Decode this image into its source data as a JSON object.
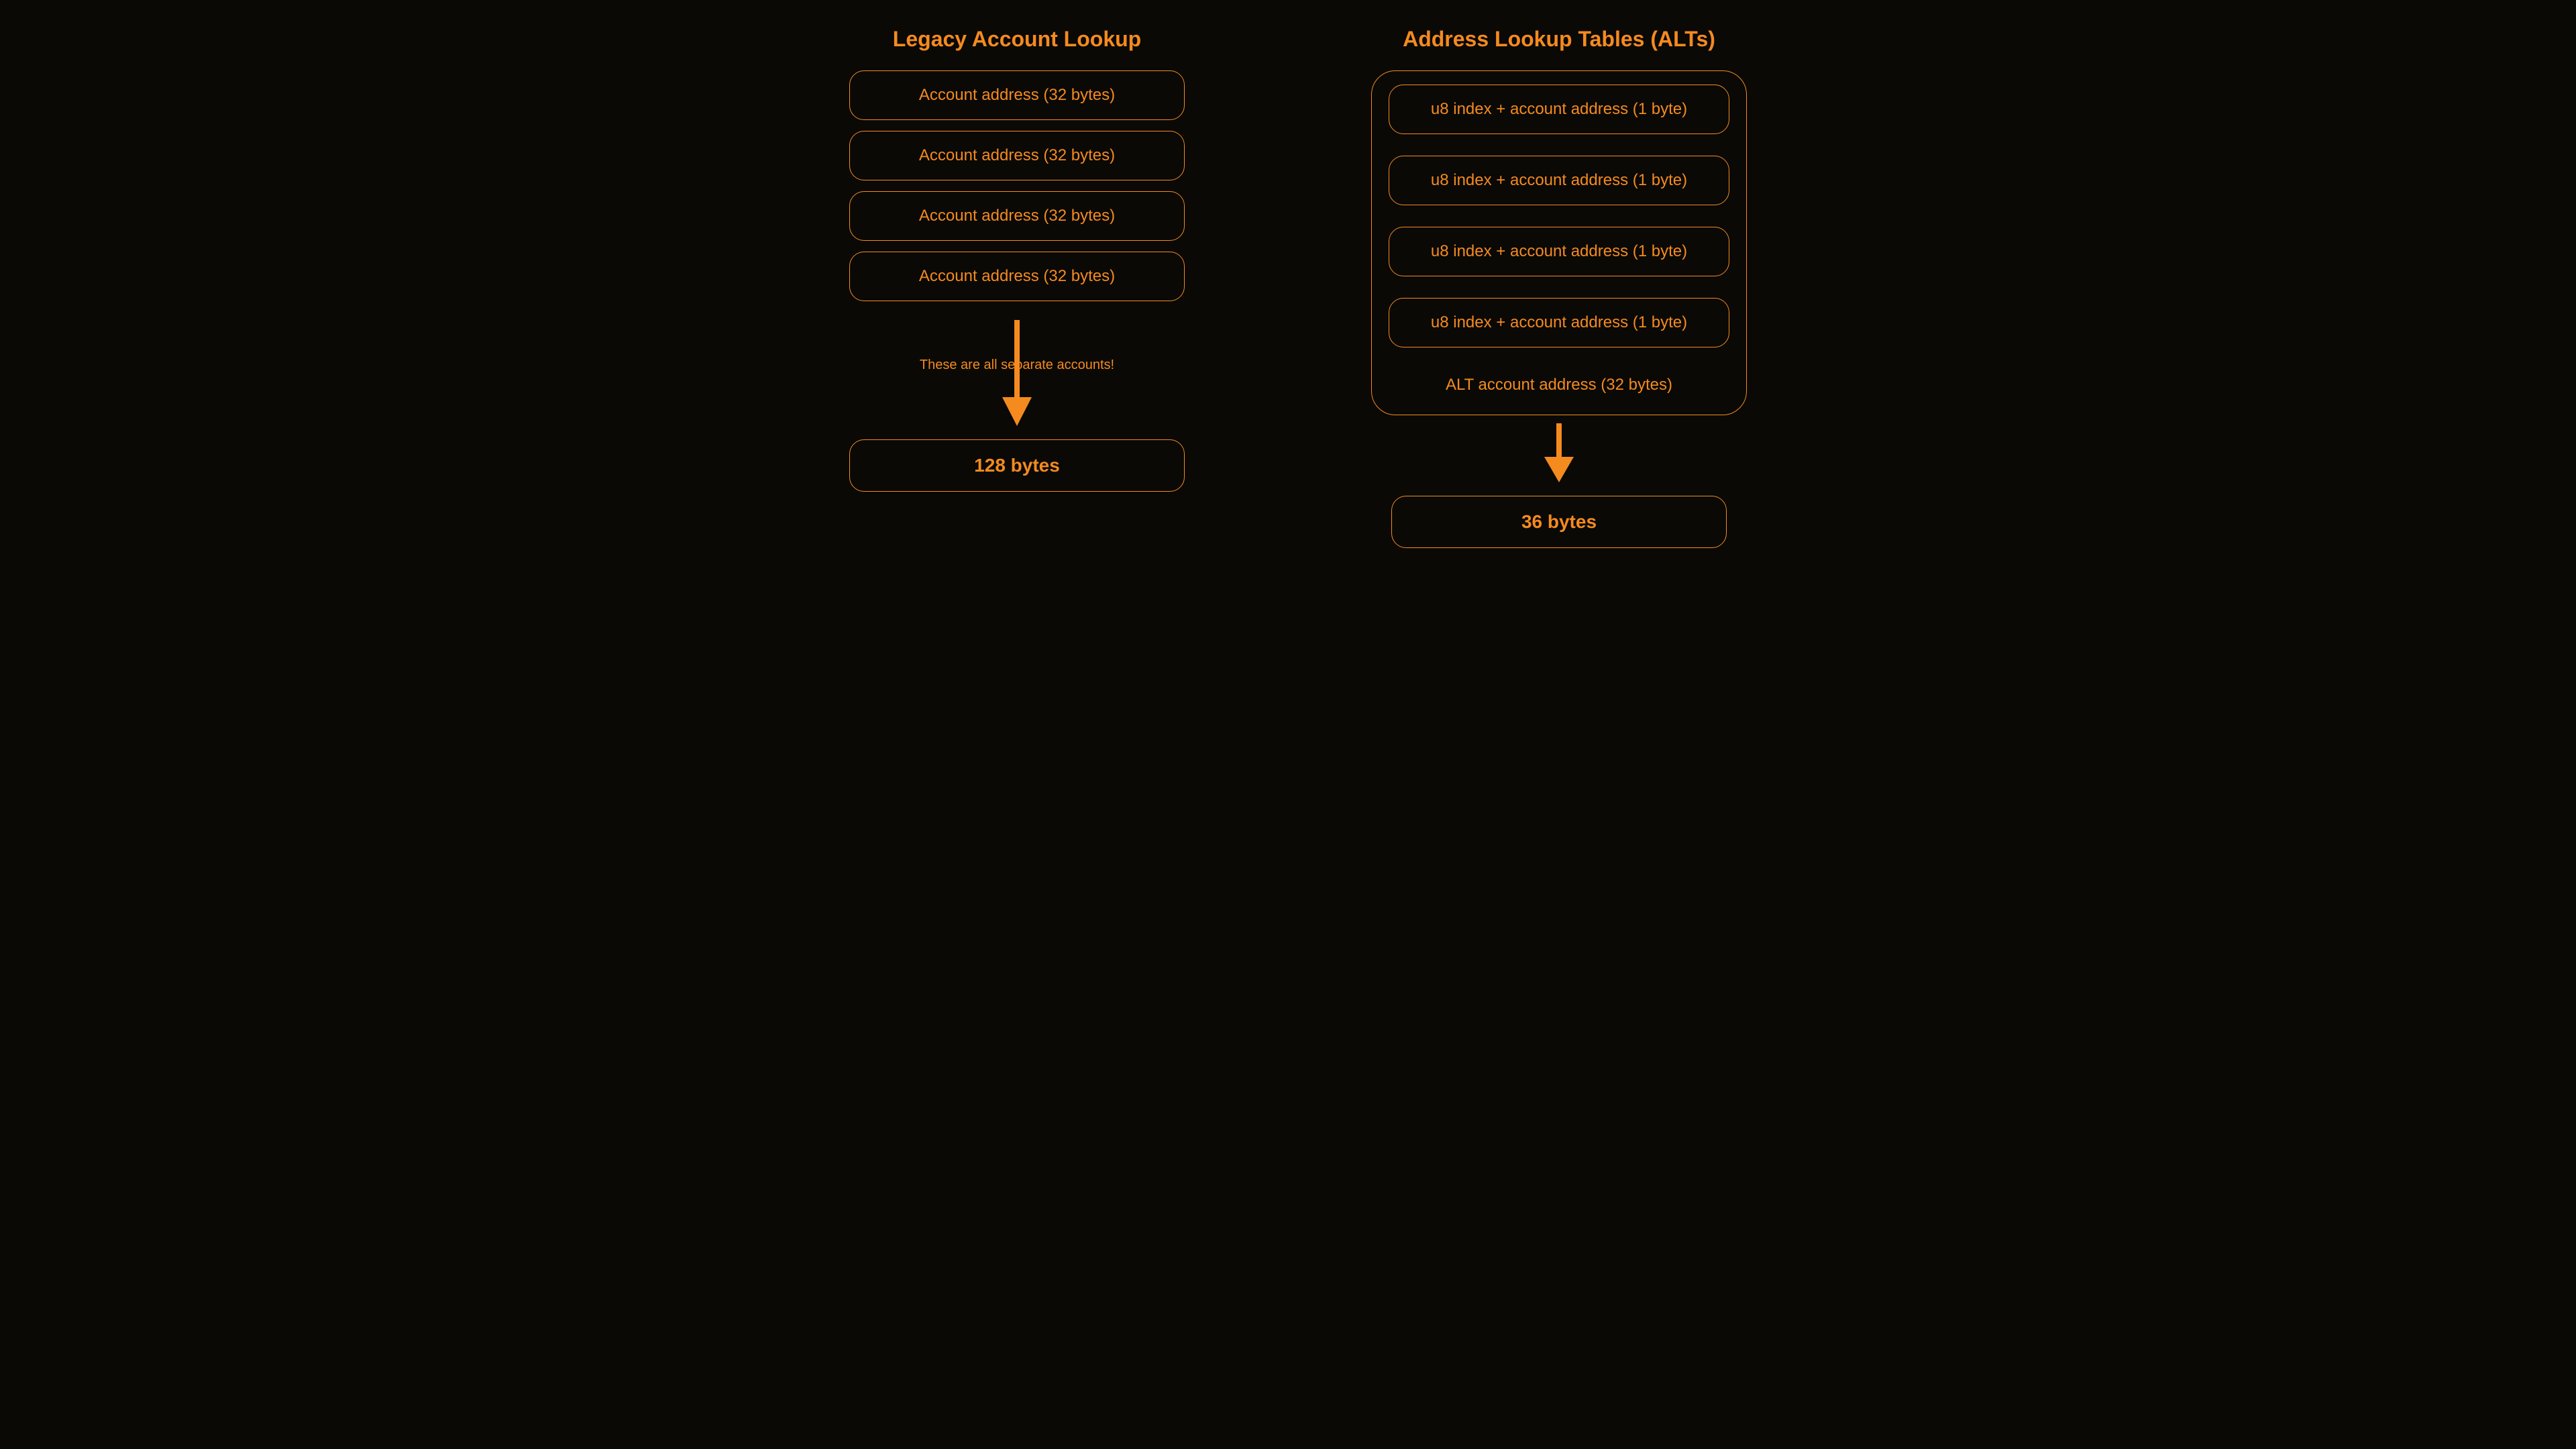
{
  "colors": {
    "accent": "#f58a1f",
    "bg": "#0a0906"
  },
  "left": {
    "title": "Legacy Account Lookup",
    "rows": [
      "Account address (32 bytes)",
      "Account address (32 bytes)",
      "Account address (32 bytes)",
      "Account address (32 bytes)"
    ],
    "arrow_caption": "These are all separate accounts!",
    "result": "128 bytes"
  },
  "right": {
    "title": "Address Lookup Tables (ALTs)",
    "rows": [
      "u8 index + account address (1 byte)",
      "u8 index + account address (1 byte)",
      "u8 index + account address (1 byte)",
      "u8 index + account address (1 byte)"
    ],
    "container_footer": "ALT account address (32 bytes)",
    "result": "36 bytes"
  }
}
